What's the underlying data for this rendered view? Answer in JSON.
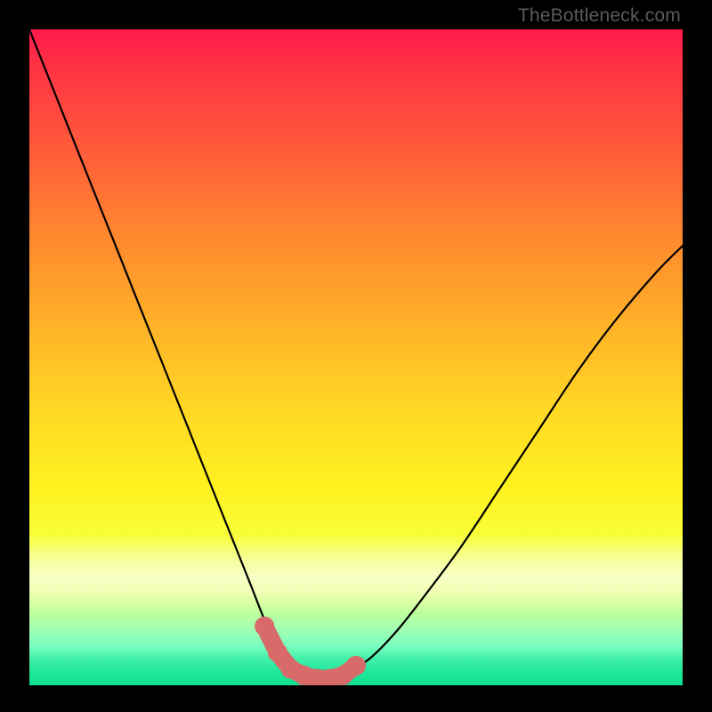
{
  "watermark": "TheBottleneck.com",
  "colors": {
    "frame": "#000000",
    "curve_stroke": "#000000",
    "marker_fill": "#d86a6a",
    "marker_stroke": "#c85a5a"
  },
  "chart_data": {
    "type": "line",
    "title": "",
    "xlabel": "",
    "ylabel": "",
    "xlim": [
      0,
      100
    ],
    "ylim": [
      0,
      100
    ],
    "grid": false,
    "legend": false,
    "annotations": [],
    "series": [
      {
        "name": "curve",
        "x": [
          0,
          4,
          8,
          12,
          16,
          20,
          24,
          28,
          30,
          32,
          34,
          36,
          38,
          40,
          42,
          44,
          46,
          48,
          52,
          56,
          60,
          66,
          72,
          78,
          84,
          90,
          96,
          100
        ],
        "y": [
          100,
          90,
          80,
          70,
          60,
          50,
          40,
          30,
          25,
          20,
          15,
          10,
          6,
          3,
          1.5,
          1,
          1,
          1.5,
          4,
          8,
          13,
          21,
          30,
          39,
          48,
          56,
          63,
          67
        ]
      }
    ],
    "markers": {
      "name": "bottom-cluster",
      "x": [
        36,
        38,
        40,
        42,
        44,
        46,
        48,
        50
      ],
      "y": [
        9,
        5,
        2.5,
        1.5,
        1,
        1,
        1.5,
        3
      ]
    }
  }
}
